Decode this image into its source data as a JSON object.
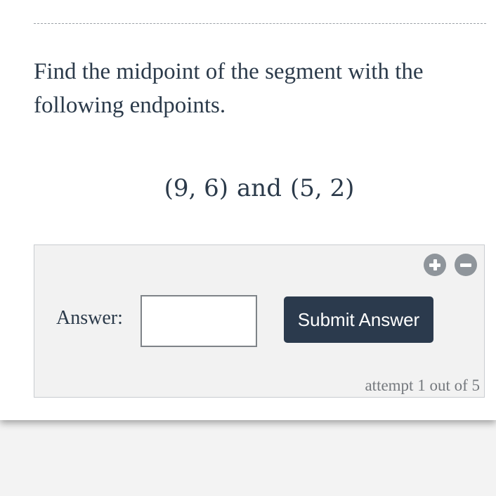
{
  "question": {
    "text": "Find the midpoint of the segment with the following endpoints."
  },
  "math": {
    "point_a": "(9, 6)",
    "connector": "and",
    "point_b": "(5, 2)"
  },
  "answer_panel": {
    "zoom_in_icon": "plus-circle-icon",
    "zoom_out_icon": "minus-circle-icon",
    "answer_label": "Answer:",
    "answer_value": "",
    "submit_label": "Submit Answer",
    "attempt_text": "attempt 1 out of 5"
  },
  "colors": {
    "text": "#2b3a4a",
    "button_bg": "#2b3a4d",
    "icon_gray": "#8f959b",
    "panel_bg": "#f2f2f2"
  }
}
